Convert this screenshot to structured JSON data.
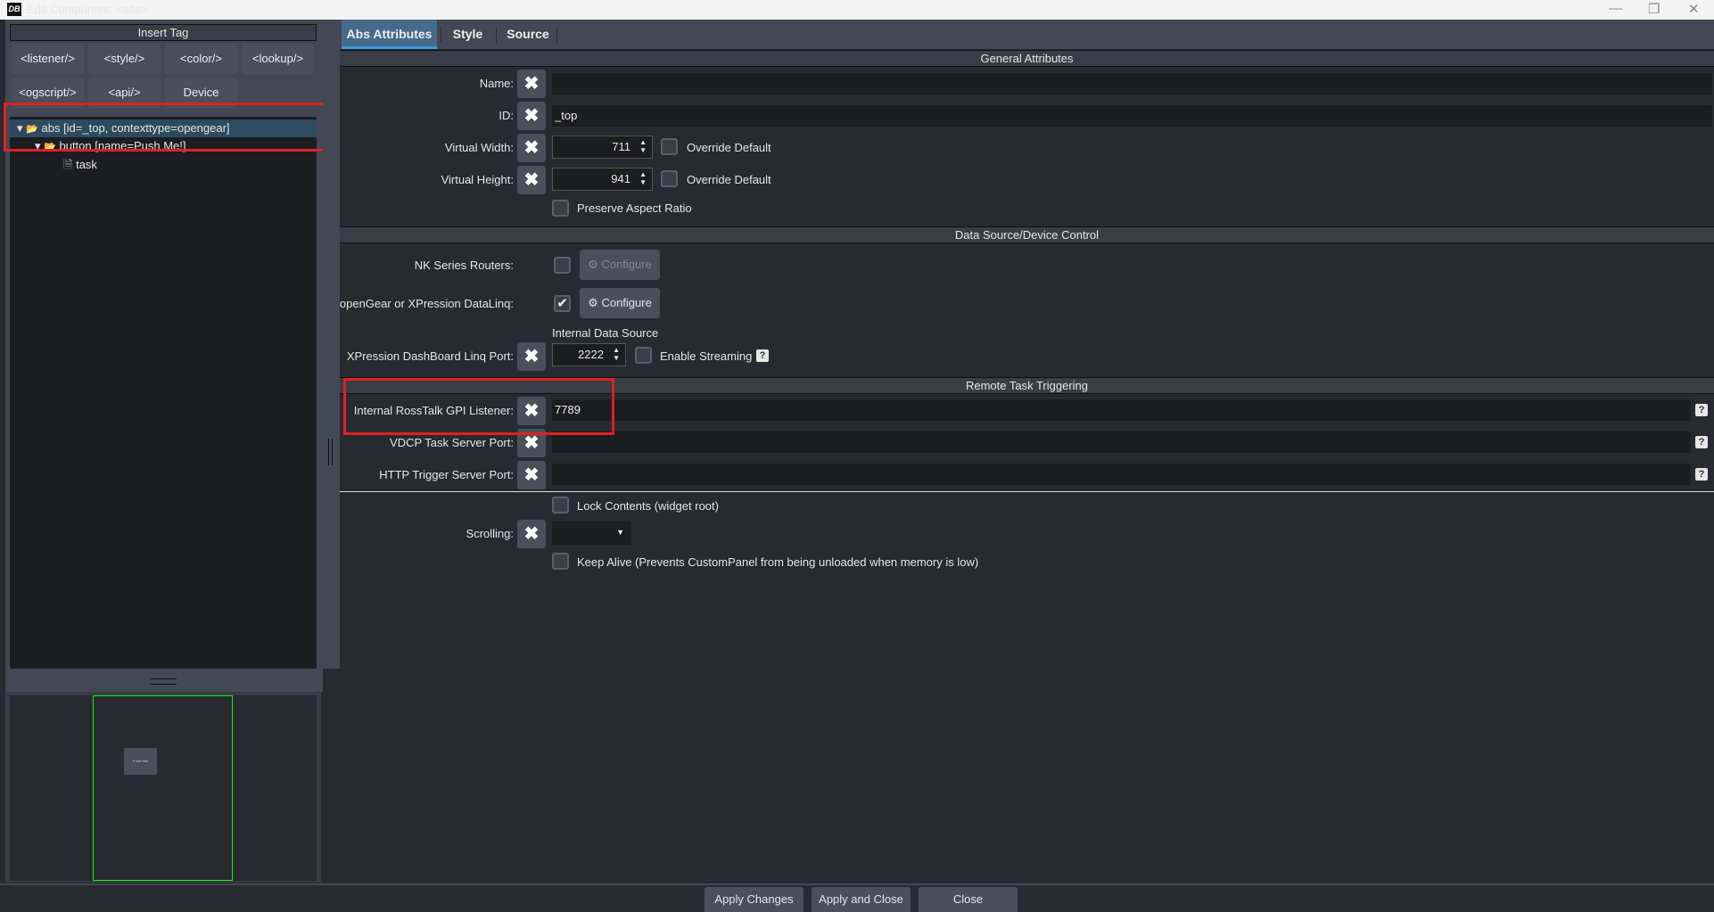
{
  "window": {
    "title": "Edit Component: <abs>",
    "logo": "DB",
    "minimize": "—",
    "restore": "❐",
    "close": "✕"
  },
  "left": {
    "insert_tag": "Insert Tag",
    "tags": [
      "<listener/>",
      "<style/>",
      "<color/>",
      "<lookup/>",
      "<ogscript/>",
      "<api/>",
      "Device"
    ],
    "tree": [
      {
        "label": "abs [id=_top, contexttype=opengear]"
      },
      {
        "label": "button [name=Push Me!]"
      },
      {
        "label": "task"
      }
    ],
    "preview_button": "Push Me!"
  },
  "tabs": [
    "Abs Attributes",
    "Style",
    "Source"
  ],
  "general": {
    "header": "General Attributes",
    "name_label": "Name:",
    "name_value": "",
    "id_label": "ID:",
    "id_value": "_top",
    "vw_label": "Virtual Width:",
    "vw_value": "711",
    "vh_label": "Virtual Height:",
    "vh_value": "941",
    "override": "Override Default",
    "preserve": "Preserve Aspect Ratio"
  },
  "datasource": {
    "header": "Data Source/Device Control",
    "nk_label": "NK Series Routers:",
    "nk_checked": false,
    "og_label": "openGear or XPression DataLinq:",
    "og_checked": true,
    "configure": "Configure",
    "internal_source": "Internal Data Source",
    "xp_label": "XPression DashBoard Linq Port:",
    "xp_value": "2222",
    "streaming": "Enable Streaming",
    "help": "?"
  },
  "remote": {
    "header": "Remote Task Triggering",
    "rosstalk_label": "Internal RossTalk GPI Listener:",
    "rosstalk_value": "7789",
    "vdcp_label": "VDCP Task Server Port:",
    "vdcp_value": "",
    "http_label": "HTTP Trigger Server Port:",
    "http_value": ""
  },
  "misc": {
    "lock": "Lock Contents (widget root)",
    "scrolling_label": "Scrolling:",
    "scrolling_value": "",
    "keepalive": "Keep Alive (Prevents CustomPanel from being unloaded when memory is low)"
  },
  "footer": {
    "apply": "Apply Changes",
    "apply_close": "Apply and Close",
    "close": "Close"
  },
  "icons": {
    "clear": "✖",
    "check": "✔",
    "gear": "⚙",
    "spin": "▲▼",
    "dropdown": "▼",
    "folder": "📂",
    "file": "🗎",
    "expand": "▾"
  }
}
